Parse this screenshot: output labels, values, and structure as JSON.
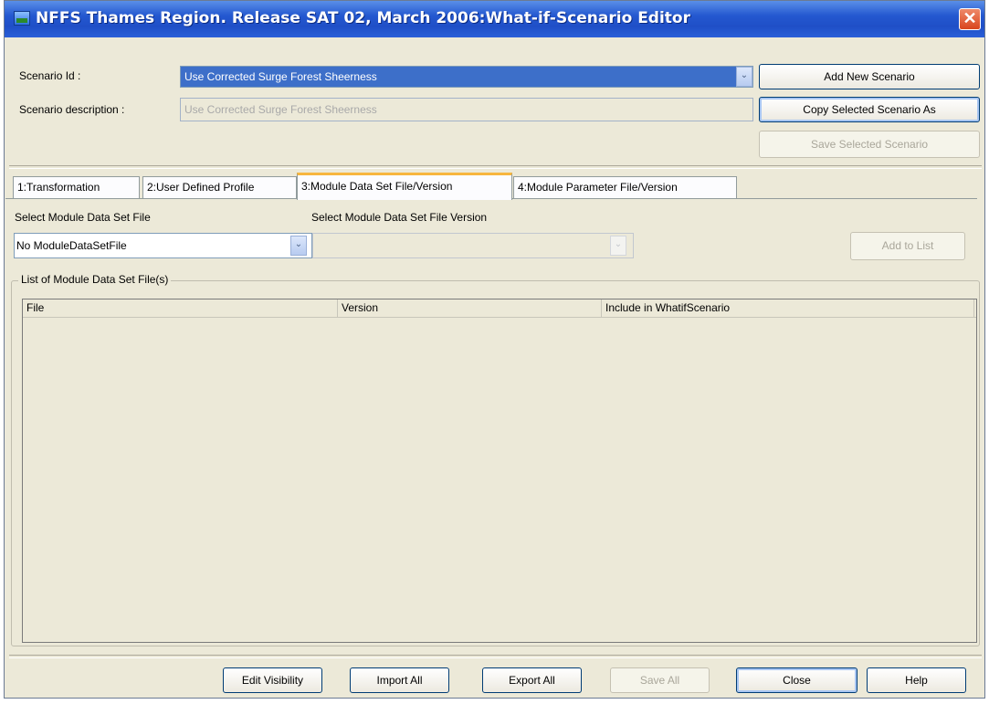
{
  "window": {
    "title": "NFFS Thames Region. Release SAT 02, March 2006:What-if-Scenario Editor",
    "close_glyph": "✕"
  },
  "scenario": {
    "id_label": "Scenario Id :",
    "id_value": "Use Corrected Surge Forest Sheerness",
    "description_label": "Scenario description :",
    "description_value": "Use Corrected Surge Forest Sheerness",
    "add_new_label": "Add New Scenario",
    "copy_selected_label": "Copy Selected Scenario As",
    "save_selected_label": "Save Selected Scenario"
  },
  "tabs": [
    {
      "label": "1:Transformation"
    },
    {
      "label": "2:User Defined Profile"
    },
    {
      "label": "3:Module Data Set File/Version",
      "active": true
    },
    {
      "label": "4:Module Parameter File/Version"
    }
  ],
  "module": {
    "file_label": "Select Module Data Set File",
    "file_value": "No ModuleDataSetFile",
    "version_label": "Select Module Data Set File Version",
    "version_value": "",
    "add_to_list_label": "Add to List"
  },
  "list": {
    "title": "List of Module Data Set File(s)",
    "columns": [
      "File",
      "Version",
      "Include in WhatifScenario"
    ],
    "rows": []
  },
  "footer": {
    "edit_visibility": "Edit Visibility",
    "import_all": "Import All",
    "export_all": "Export All",
    "save_all": "Save All",
    "close": "Close",
    "help": "Help"
  },
  "icons": {
    "dropdown_arrow": "⌄"
  },
  "colors": {
    "title_bar": "#2458d0",
    "selection": "#3d6fc9",
    "active_tab_accent": "#f7b63e",
    "window_bg": "#ece9d8"
  }
}
